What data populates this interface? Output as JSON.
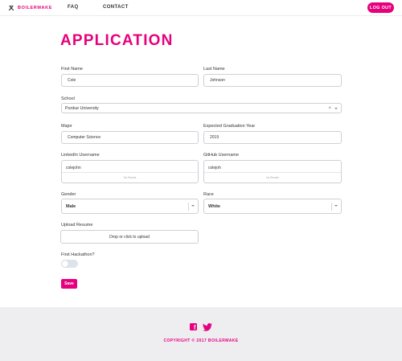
{
  "nav": {
    "brand": "BOILERMAKE",
    "links": [
      "FAQ",
      "CONTACT"
    ],
    "logout_label": "LOG OUT",
    "logo_icon": "crossed-hammers-icon"
  },
  "page": {
    "title": "APPLICATION"
  },
  "form": {
    "first_name": {
      "label": "First Name",
      "value": "Cole"
    },
    "last_name": {
      "label": "Last Name",
      "value": "Johnson"
    },
    "school": {
      "label": "School",
      "value": "Purdue University",
      "clear": "×"
    },
    "major": {
      "label": "Major",
      "value": "Computer Science"
    },
    "grad_year": {
      "label": "Expected Graduation Year",
      "value": "2019"
    },
    "linkedin": {
      "label": "LinkedIn Username",
      "value": "colejohn",
      "no_results": "No Results"
    },
    "github": {
      "label": "GitHub Username",
      "value": "colejoh",
      "no_results": "No Results"
    },
    "gender": {
      "label": "Gender",
      "value": "Male"
    },
    "race": {
      "label": "Race",
      "value": "White"
    },
    "resume": {
      "label": "Upload Resume",
      "placeholder": "Drop or click to upload"
    },
    "first_hackathon": {
      "label": "First Hackathon?",
      "checked": false
    },
    "save_label": "Save"
  },
  "footer": {
    "copyright": "COPYRIGHT © 2017 BOILERMAKE",
    "icons": [
      "facebook-icon",
      "twitter-icon"
    ]
  },
  "colors": {
    "accent": "#e6007e",
    "footer_bg": "#eeeef0"
  }
}
